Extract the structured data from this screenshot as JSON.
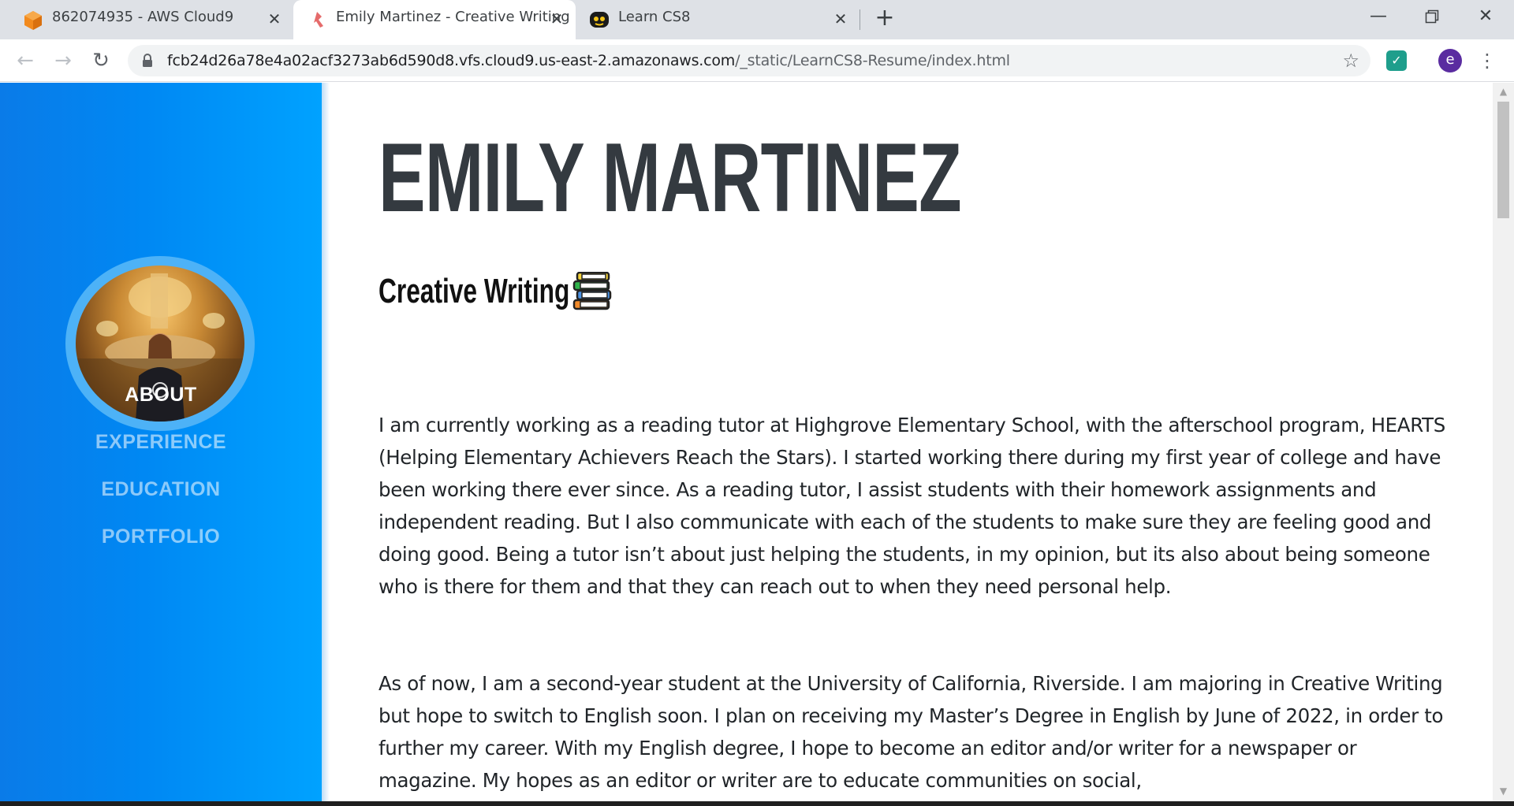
{
  "browser": {
    "tabs": [
      {
        "title": "862074935 - AWS Cloud9",
        "icon": "aws-cloud9-icon",
        "active": false
      },
      {
        "title": "Emily Martinez - Creative Writing",
        "icon": "site-favicon",
        "active": true
      },
      {
        "title": "Learn CS8",
        "icon": "learncs8-icon",
        "active": false
      }
    ],
    "new_tab_label": "+",
    "url_host": "fcb24d26a78e4a02acf3273ab6d590d8.vfs.cloud9.us-east-2.amazonaws.com",
    "url_path": "/_static/LearnCS8-Resume/index.html",
    "profile_initial": "e"
  },
  "sidebar": {
    "nav": [
      {
        "label": "ABOUT",
        "active": true
      },
      {
        "label": "EXPERIENCE",
        "active": false
      },
      {
        "label": "EDUCATION",
        "active": false
      },
      {
        "label": "PORTFOLIO",
        "active": false
      }
    ]
  },
  "main": {
    "name": "EMILY MARTINEZ",
    "subtitle": "Creative Writing",
    "paragraphs": [
      "I am currently working as a reading tutor at Highgrove Elementary School, with the afterschool program, HEARTS (Helping Elementary Achievers Reach the Stars). I started working there during my first year of college and have been working there ever since. As a reading tutor, I assist students with their homework assignments and independent reading. But I also communicate with each of the students to make sure they are feeling good and doing good. Being a tutor isn’t about just helping the students, in my opinion, but its also about being someone who is there for them and that they can reach out to when they need personal help.",
      "As of now, I am a second-year student at the University of California, Riverside. I am majoring in Creative Writing but hope to switch to English soon. I plan on receiving my Master’s Degree in English by June of 2022, in order to further my career. With my English degree, I hope to become an editor and/or writer for a newspaper or magazine. My hopes as an editor or writer are to educate communities on social,"
    ]
  },
  "colors": {
    "sidebar_start": "#0a7be8",
    "sidebar_end": "#00a2ff",
    "heading": "#343a40",
    "body_text": "#212529"
  }
}
